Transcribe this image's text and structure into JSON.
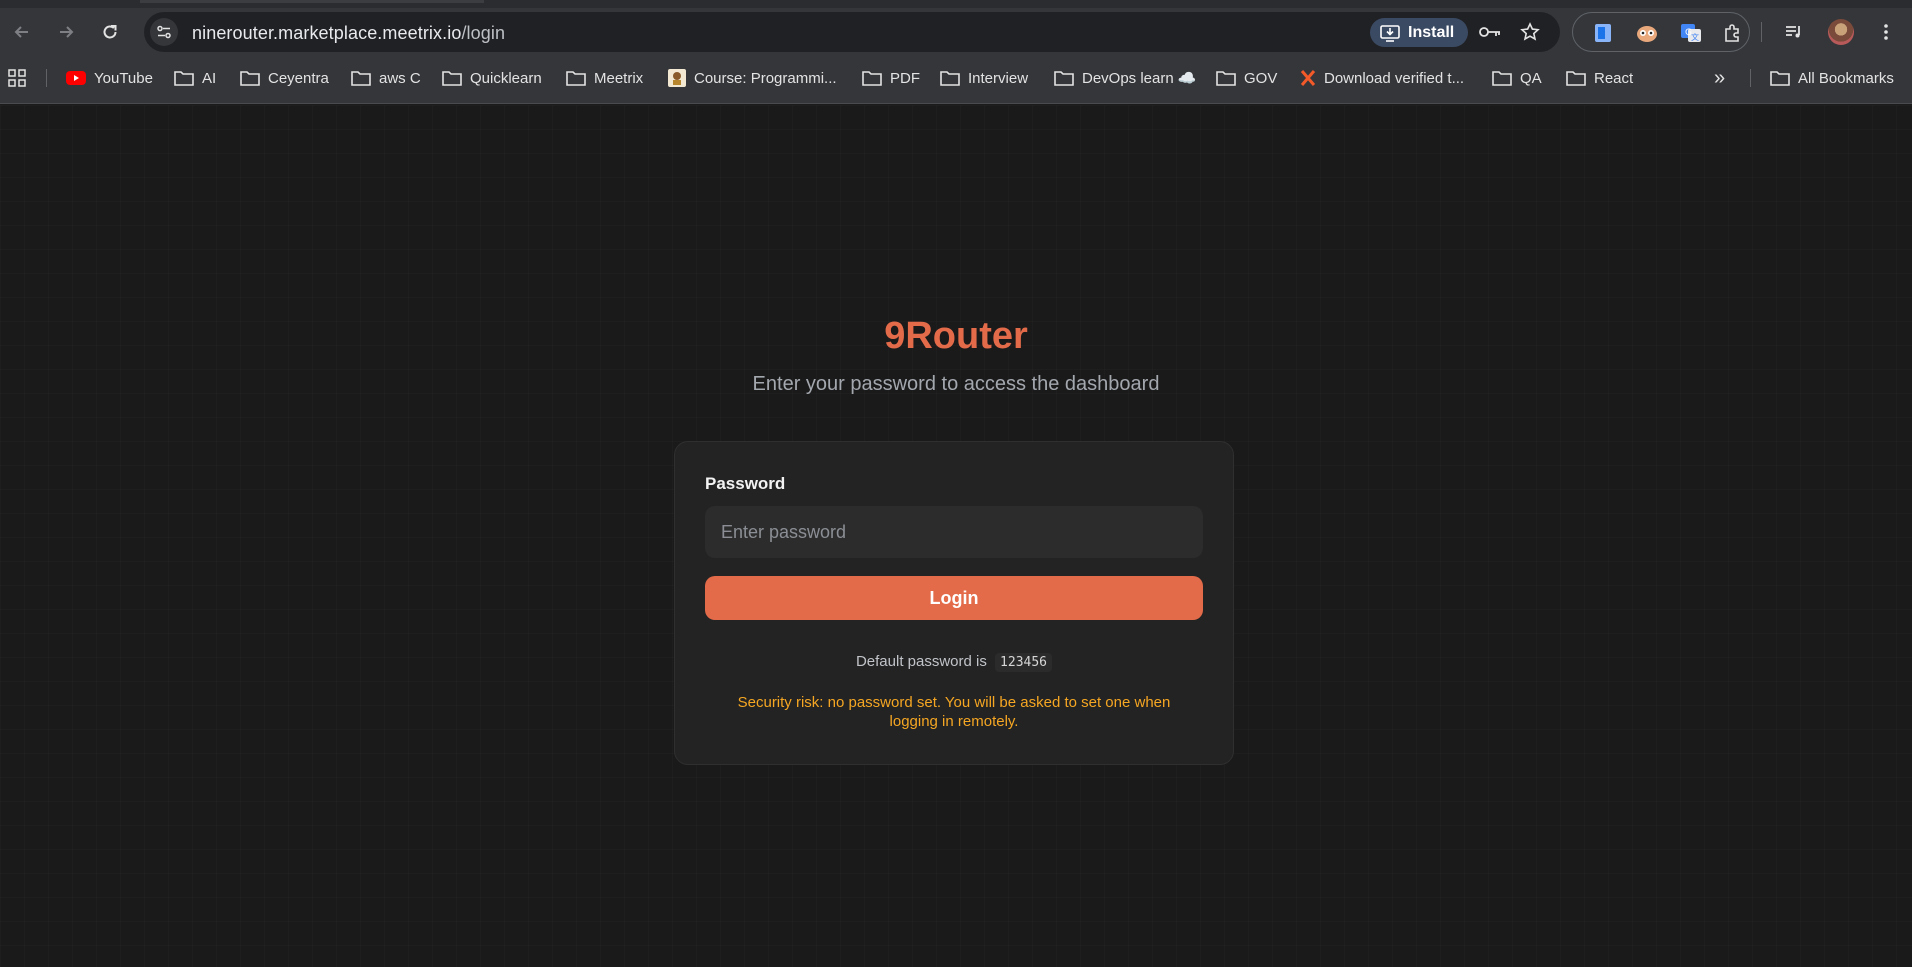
{
  "browser": {
    "url_host": "ninerouter.marketplace.meetrix.io",
    "url_path": "/login",
    "install_label": "Install",
    "bookmarks": [
      {
        "label": "YouTube",
        "icon": "youtube-icon"
      },
      {
        "label": "AI",
        "icon": "folder-icon"
      },
      {
        "label": "Ceyentra",
        "icon": "folder-icon"
      },
      {
        "label": "aws C",
        "icon": "folder-icon"
      },
      {
        "label": "Quicklearn",
        "icon": "folder-icon"
      },
      {
        "label": "Meetrix",
        "icon": "folder-icon"
      },
      {
        "label": "Course: Programmi...",
        "icon": "course-favicon"
      },
      {
        "label": "PDF",
        "icon": "folder-icon"
      },
      {
        "label": "Interview",
        "icon": "folder-icon"
      },
      {
        "label": "DevOps learn ☁️",
        "icon": "folder-icon"
      },
      {
        "label": "GOV",
        "icon": "folder-icon"
      },
      {
        "label": "Download verified t...",
        "icon": "x-favicon"
      },
      {
        "label": "QA",
        "icon": "folder-icon"
      },
      {
        "label": "React",
        "icon": "folder-icon"
      }
    ],
    "overflow_label": "»",
    "all_bookmarks_label": "All Bookmarks"
  },
  "login": {
    "brand": "9Router",
    "subtitle": "Enter your password to access the dashboard",
    "password_label": "Password",
    "password_placeholder": "Enter password",
    "login_button": "Login",
    "hint_prefix": "Default password is",
    "default_password": "123456",
    "warning": "Security risk: no password set. You will be asked to set one when logging in remotely."
  },
  "colors": {
    "accent": "#e36b4a",
    "warning": "#f5a623",
    "background": "#1a1a1a",
    "card": "#232323"
  }
}
